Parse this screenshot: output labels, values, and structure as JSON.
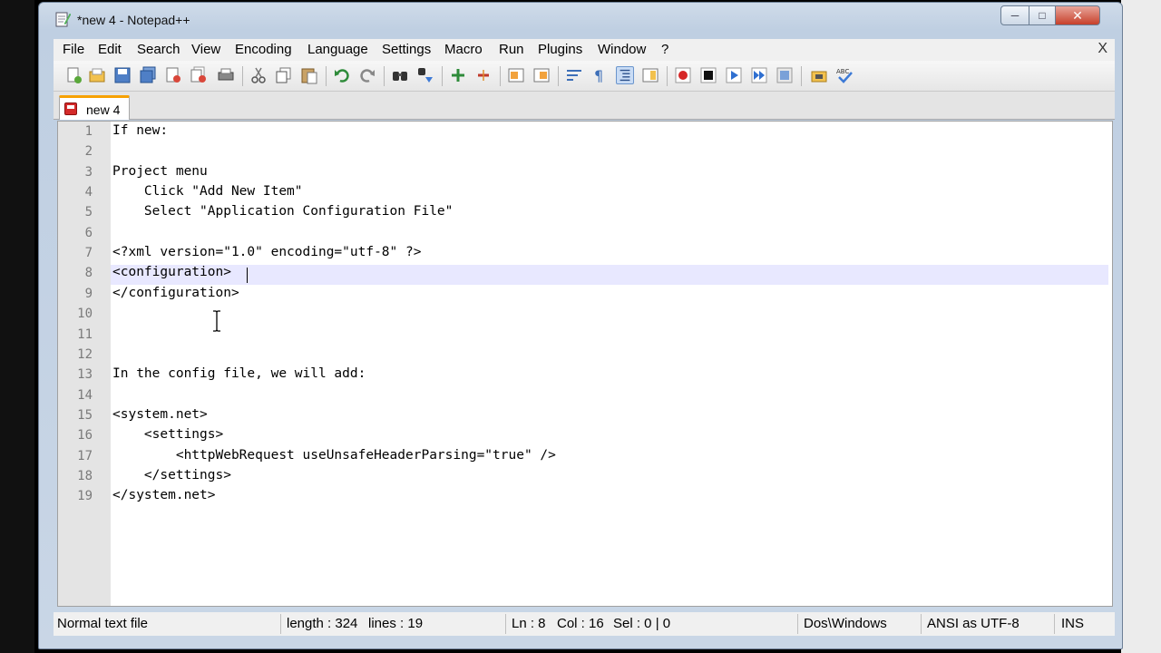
{
  "window": {
    "title": "*new 4 - Notepad++"
  },
  "menu": {
    "items": [
      "File",
      "Edit",
      "Search",
      "View",
      "Encoding",
      "Language",
      "Settings",
      "Macro",
      "Run",
      "Plugins",
      "Window",
      "?"
    ],
    "close": "X"
  },
  "toolbar": {
    "icons": [
      "new-file-icon",
      "open-file-icon",
      "save-icon",
      "save-all-icon",
      "close-icon",
      "close-all-icon",
      "print-icon",
      "cut-icon",
      "copy-icon",
      "paste-icon",
      "undo-icon",
      "redo-icon",
      "find-icon",
      "replace-icon",
      "zoom-in-icon",
      "zoom-out-icon",
      "sync-vertical-icon",
      "sync-horizontal-icon",
      "word-wrap-icon",
      "show-all-chars-icon",
      "indent-guide-icon",
      "doc-map-icon",
      "record-macro-icon",
      "stop-macro-icon",
      "play-macro-icon",
      "run-macro-multiple-icon",
      "save-macro-icon",
      "open-folder-icon",
      "spell-check-icon"
    ]
  },
  "tabs": [
    {
      "label": "new 4",
      "active": true
    }
  ],
  "editor": {
    "lines": [
      "If new:",
      "",
      "Project menu",
      "    Click \"Add New Item\"",
      "    Select \"Application Configuration File\"",
      "",
      "<?xml version=\"1.0\" encoding=\"utf-8\" ?>",
      "<configuration>",
      "</configuration>",
      "",
      "",
      "",
      "In the config file, we will add:",
      "",
      "<system.net>",
      "    <settings>",
      "        <httpWebRequest useUnsafeHeaderParsing=\"true\" />",
      "    </settings>",
      "</system.net>"
    ],
    "line_numbers": [
      "1",
      "2",
      "3",
      "4",
      "5",
      "6",
      "7",
      "8",
      "9",
      "10",
      "11",
      "12",
      "13",
      "14",
      "15",
      "16",
      "17",
      "18",
      "19"
    ],
    "current_line": 8
  },
  "status": {
    "file_type": "Normal text file",
    "length": "length : 324",
    "lines": "lines : 19",
    "ln": "Ln : 8",
    "col": "Col : 16",
    "sel": "Sel : 0 | 0",
    "eol": "Dos\\Windows",
    "encoding": "ANSI as UTF-8",
    "mode": "INS"
  },
  "colors": {
    "tab_accent": "#f7a100",
    "current_line_bg": "#e8e8ff",
    "gutter_bg": "#e4e4e4"
  }
}
